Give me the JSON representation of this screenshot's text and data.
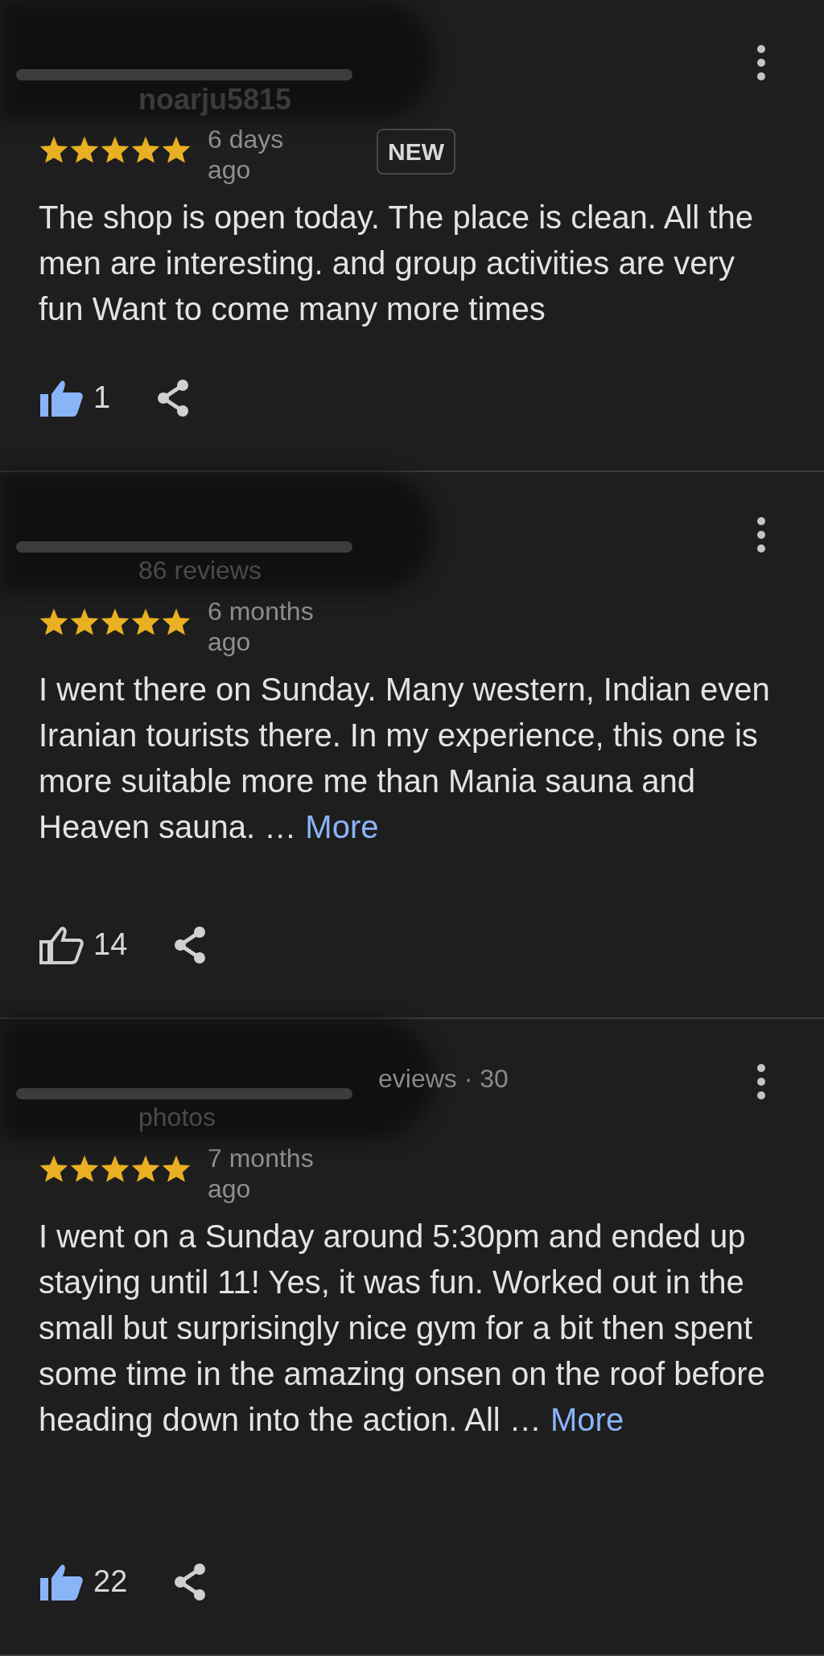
{
  "reviews": [
    {
      "author": "noarju5815",
      "stars": 5,
      "date": "6 days ago",
      "badge": "NEW",
      "text": "The shop is open today. The place is clean. All the men are interesting. and group activities are very fun Want to come many more times",
      "likes": "1",
      "liked": true
    },
    {
      "meta": [
        {
          "text": "86 reviews",
          "kind": "plain"
        }
      ],
      "stars": 5,
      "date": "6 months ago",
      "text": "I went there on Sunday. Many western, Indian even Iranian tourists there. In my experience, this one is more suitable more me than Mania sauna and Heaven sauna. …",
      "more": "More",
      "likes": "14",
      "liked": false
    },
    {
      "meta": [
        {
          "text": "eviews · 30",
          "kind": "cut"
        },
        {
          "text": "photos",
          "kind": "plain"
        }
      ],
      "stars": 5,
      "date": "7 months ago",
      "text": "I went on a Sunday around 5:30pm and ended up staying until 11! Yes, it was fun. Worked out in the small but surprisingly nice gym for a bit then spent some time in the amazing onsen on the roof before heading down into the action. All …",
      "more": "More",
      "likes": "22",
      "liked": true
    }
  ]
}
